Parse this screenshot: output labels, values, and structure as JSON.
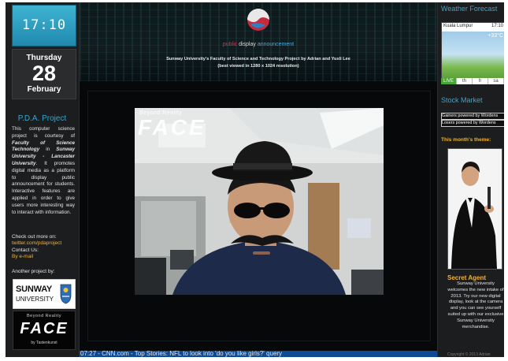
{
  "left": {
    "clock": "17:10",
    "date": {
      "weekday": "Thursday",
      "day": "28",
      "month": "February"
    },
    "pda_title": "P.D.A. Project",
    "pda_text_1": "This computer science project is courtesy of",
    "pda_faculty": "Faculty of Science Technology",
    "pda_text_2": "in",
    "pda_uni": "Sunway University - Lancaster University",
    "pda_text_3": ". It promotes digital media as a platform to display public announcement for students. Interactive features are applied in order to give users more interesting way to interact with information.",
    "check_out": "Check out more on:",
    "twitter": "twitter.com/pdaproject",
    "contact": "Contact Us:",
    "email": "By e-mail",
    "another": "Another project by:",
    "sunway_logo_line1": "SUNWAY",
    "sunway_logo_line2": "UNIVERSITY",
    "face_logo": {
      "tagline": "Beyond Reality",
      "name": "FACE",
      "by": "by Tastenkunst"
    }
  },
  "header": {
    "brand_part1": "public ",
    "brand_part2": "display ",
    "brand_part3": "announcement",
    "subtitle_1": "Sunway University's Faculty of Science and Technology Project by Adrian and Yusli Lee",
    "subtitle_2": "(best viewed in 1280 x 1024 resolution)"
  },
  "video": {
    "overlay_tagline": "Beyond Reality",
    "overlay_name": "FACE"
  },
  "ticker": "07:27 - CNN.com - Top Stories: NFL to look into 'do you like girls?' query",
  "right": {
    "weather_title": "Weather Forecast",
    "weather_city": "Kuala Lumpur",
    "weather_time": "17:10",
    "weather_temp": "+33°C",
    "weather_tabs": [
      "LIVE",
      "th",
      "fr",
      "sa"
    ],
    "stock_title": "Stock Market",
    "stock_line_1": "Gainers  powered by Wordens",
    "stock_line_2": "Losers  powered by Wordens",
    "theme_title": "This month's theme:",
    "secret_title": "Secret Agent",
    "secret_text": "Sunway University welcomes the new intake of 2013. Try our new digital display, look at the camera and you can see yourself suited up with our exclusive Sunway University merchandise.",
    "copyright": "Copyright © 2013 Adrian"
  },
  "colors": {
    "accent_blue": "#38a7d0",
    "accent_orange": "#f2b233",
    "ticker_bg": "#0e4a93"
  }
}
